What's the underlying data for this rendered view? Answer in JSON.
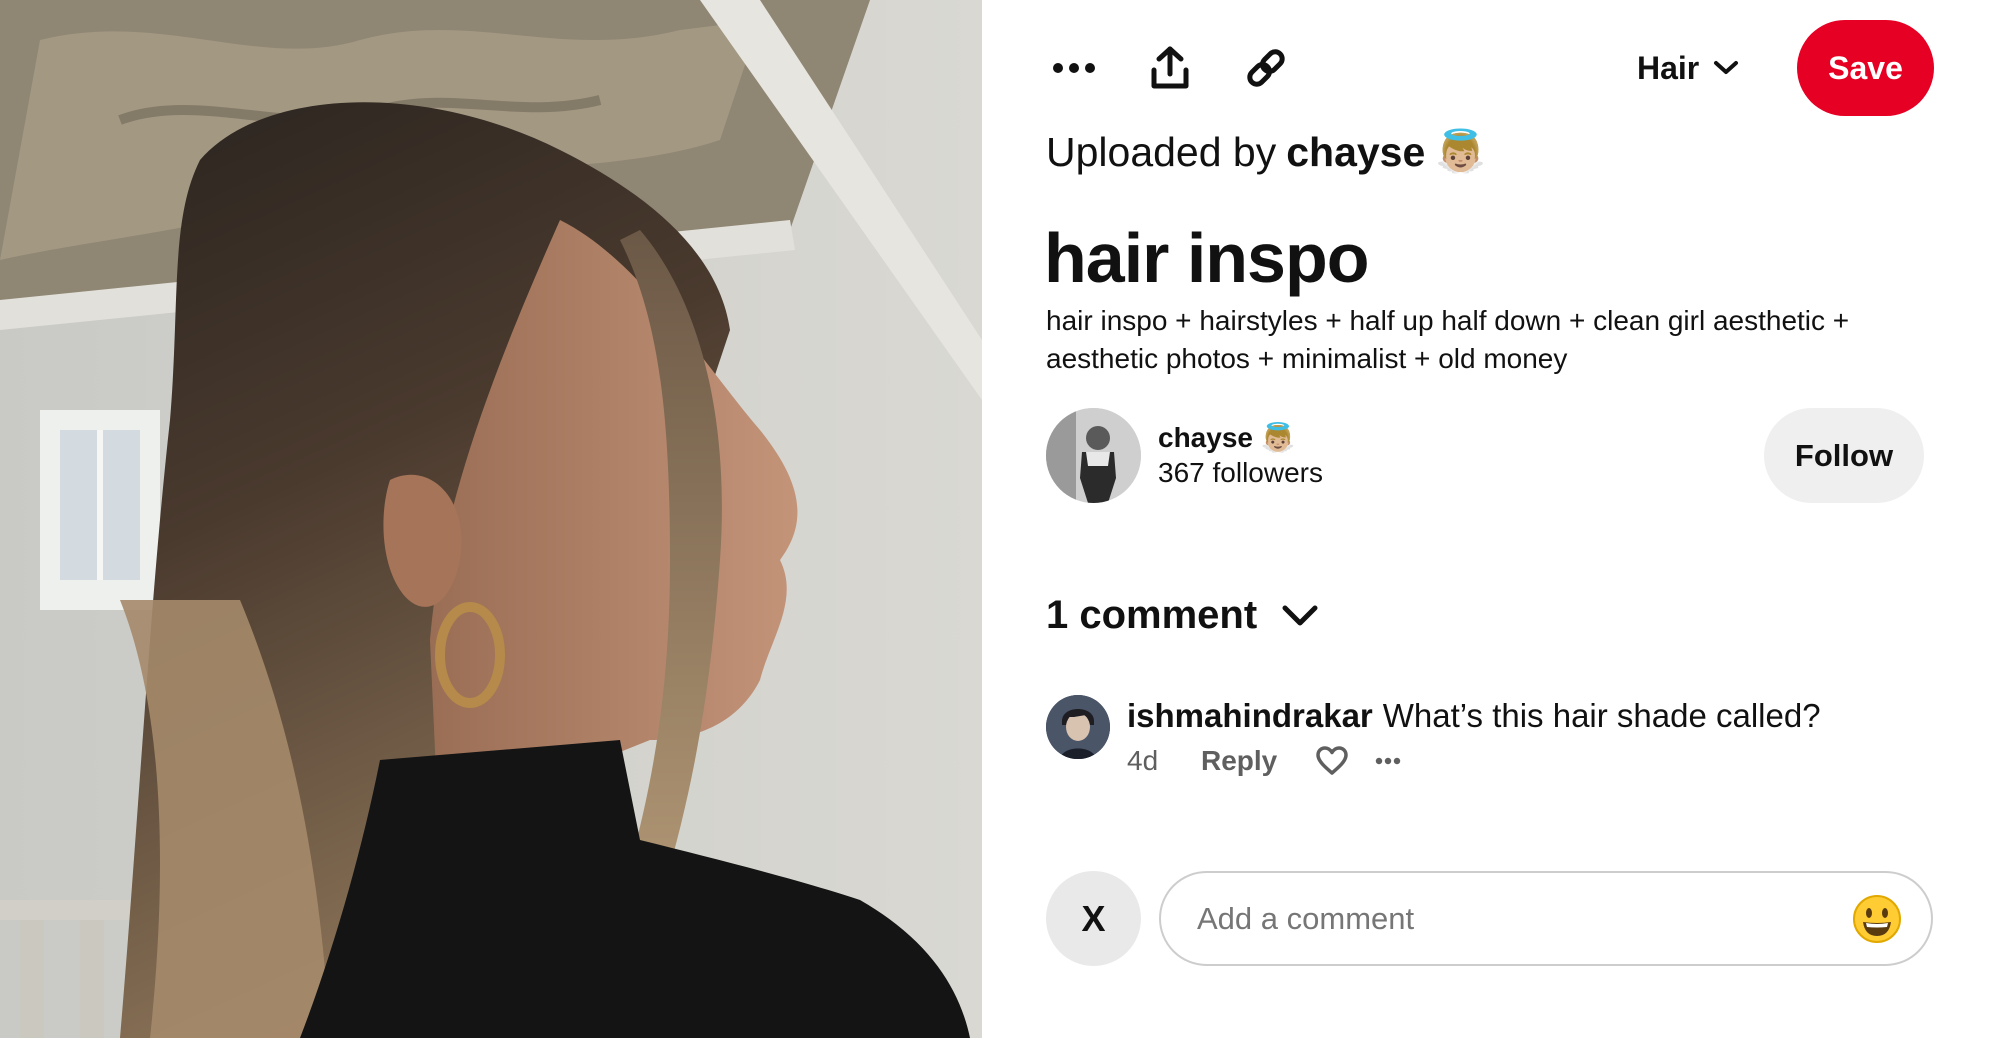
{
  "pin": {
    "uploaded_prefix": "Uploaded by",
    "uploader_name": "chayse",
    "uploader_emoji": "👼🏼",
    "title": "hair inspo",
    "description": "hair inspo + hairstyles + half up half down + clean girl aesthetic + aesthetic photos + minimalist + old money"
  },
  "toolbar": {
    "more_icon": "more-horizontal-icon",
    "share_icon": "share-upload-icon",
    "link_icon": "link-chain-icon",
    "board_label": "Hair",
    "save_label": "Save"
  },
  "creator": {
    "name": "chayse 👼🏼",
    "followers": "367 followers",
    "follow_label": "Follow"
  },
  "comments": {
    "heading": "1 comment",
    "items": [
      {
        "user": "ishmahindrakar",
        "text": "What’s this hair shade called?",
        "age": "4d",
        "reply_label": "Reply"
      }
    ]
  },
  "composer": {
    "avatar_initial": "X",
    "placeholder": "Add a comment",
    "emoji_icon": "smiley-emoji-icon"
  },
  "colors": {
    "save_red": "#e60023",
    "follow_grey": "#efefef",
    "text": "#111111"
  }
}
